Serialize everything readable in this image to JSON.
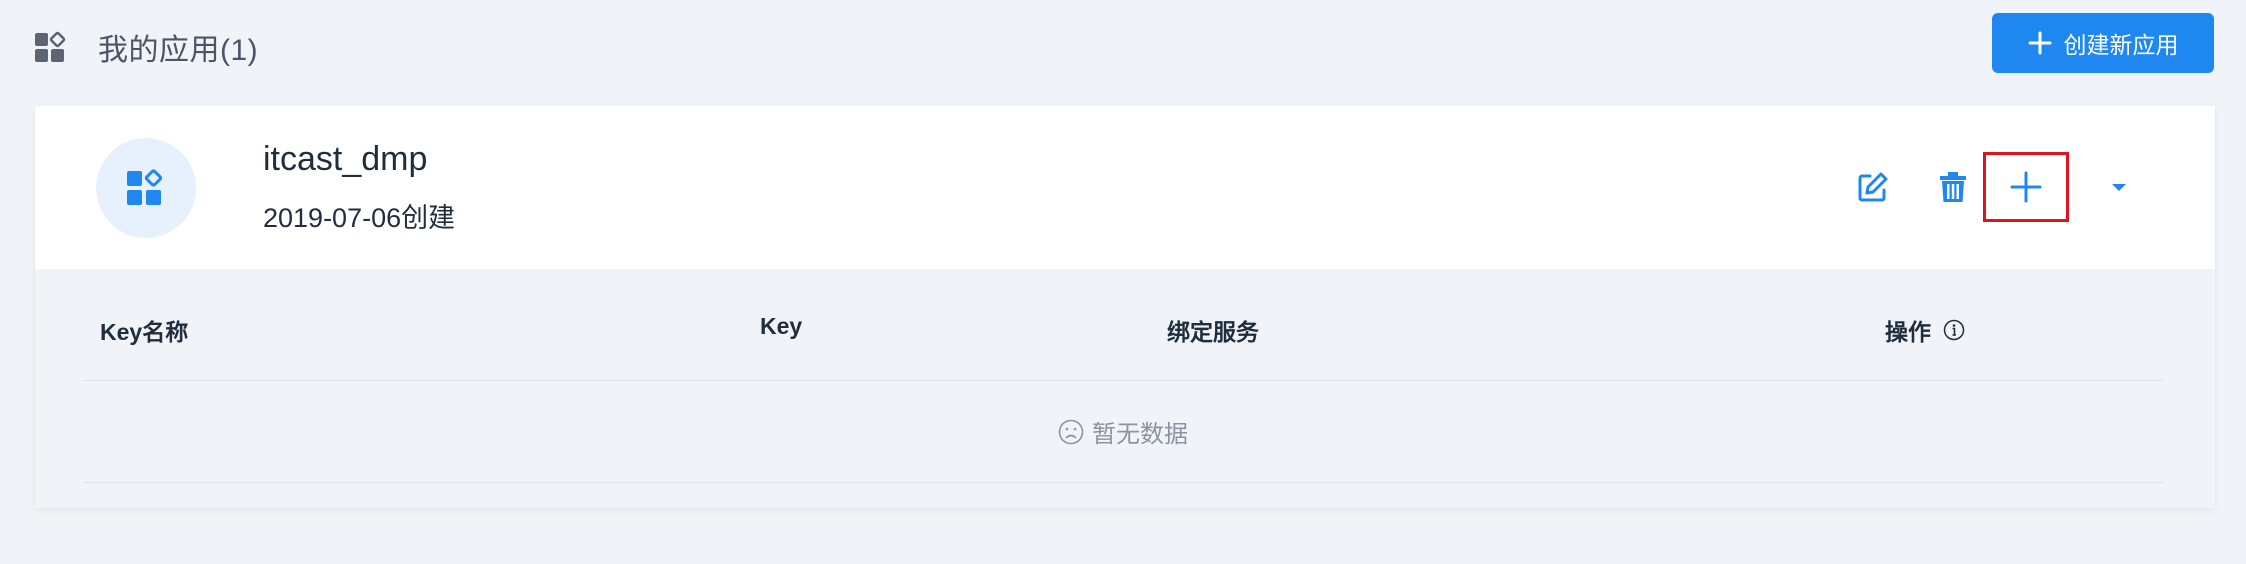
{
  "header": {
    "title": "我的应用(1)",
    "create_button_label": "创建新应用"
  },
  "app": {
    "name": "itcast_dmp",
    "created": "2019-07-06创建"
  },
  "table": {
    "columns": [
      "Key名称",
      "Key",
      "绑定服务",
      "操作"
    ],
    "empty_text": "暂无数据"
  },
  "icons": {
    "header": "apps-icon",
    "avatar": "apps-icon",
    "edit": "edit-icon",
    "delete": "trash-icon",
    "add": "plus-icon",
    "more": "caret-down-icon",
    "info": "info-icon",
    "empty": "frown-icon"
  },
  "colors": {
    "accent": "#1e88f0",
    "highlight_box": "#e0141e",
    "background": "#f0f3f7"
  }
}
